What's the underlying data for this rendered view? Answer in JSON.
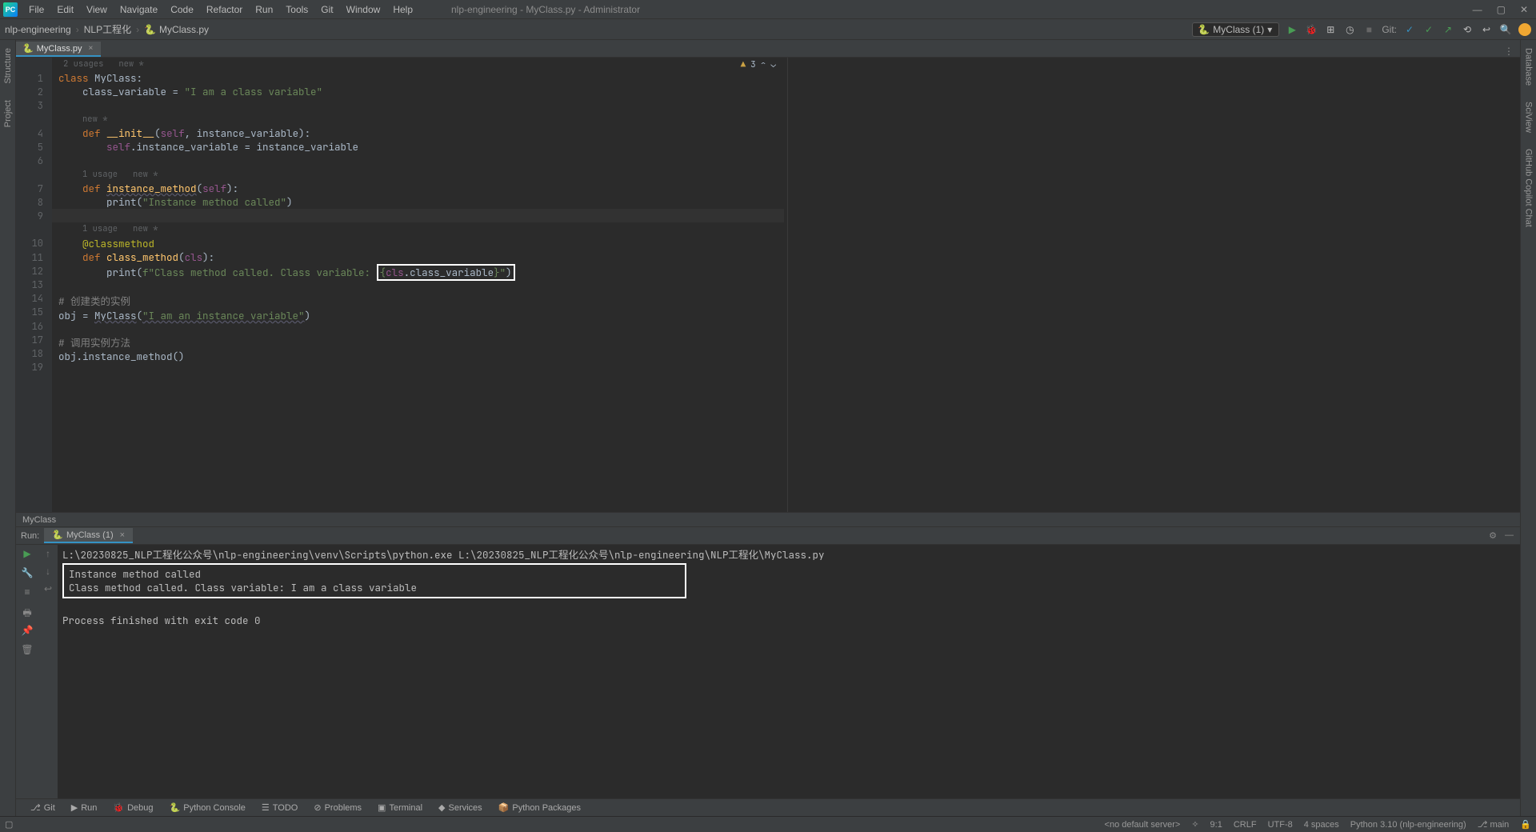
{
  "menu": [
    "File",
    "Edit",
    "View",
    "Navigate",
    "Code",
    "Refactor",
    "Run",
    "Tools",
    "Git",
    "Window",
    "Help"
  ],
  "window_title": "nlp-engineering - MyClass.py - Administrator",
  "breadcrumb": [
    "nlp-engineering",
    "NLP工程化",
    "MyClass.py"
  ],
  "run_config": "MyClass (1)",
  "git_label": "Git:",
  "left_tabs": [
    "Structure",
    "Project"
  ],
  "right_tabs": [
    "Database",
    "SciView",
    "GitHub Copilot Chat"
  ],
  "file_tab": "MyClass.py",
  "inspection": {
    "warnings": "3"
  },
  "code": {
    "hint1_a": "2 usages",
    "hint1_b": "new *",
    "l1_a": "class ",
    "l1_b": "MyClass",
    "l1_c": ":",
    "l2_a": "    class_variable = ",
    "l2_b": "\"I am a class variable\"",
    "hint2_b": "new *",
    "l4_a": "    ",
    "l4_def": "def ",
    "l4_name": "__init__",
    "l4_b": "(",
    "l4_self": "self",
    "l4_c": ", instance_variable):",
    "l5_a": "        ",
    "l5_self": "self",
    "l5_b": ".instance_variable = instance_variable",
    "hint3_a": "1 usage",
    "hint3_b": "new *",
    "l7_a": "    ",
    "l7_def": "def ",
    "l7_name": "instance_method",
    "l7_b": "(",
    "l7_self": "self",
    "l7_c": "):",
    "l8_a": "        ",
    "l8_print": "print",
    "l8_b": "(",
    "l8_str": "\"Instance method called\"",
    "l8_c": ")",
    "hint4_a": "1 usage",
    "hint4_b": "new *",
    "l10": "    @classmethod",
    "l11_a": "    ",
    "l11_def": "def ",
    "l11_name": "class_method",
    "l11_b": "(",
    "l11_cls": "cls",
    "l11_c": "):",
    "l12_a": "        ",
    "l12_print": "print",
    "l12_b": "(",
    "l12_f": "f\"Class method called. Class variable: ",
    "l12_box_open": "{",
    "l12_cls": "cls",
    "l12_dot": ".class_variable",
    "l12_box_close": "}",
    "l12_end": "\")",
    "l14": "# 创建类的实例",
    "l15_a": "obj = ",
    "l15_b": "MyClass",
    "l15_c": "(",
    "l15_d": "\"I am an instance variable\"",
    "l15_e": ")",
    "l17": "# 调用实例方法",
    "l18": "obj.instance_method()"
  },
  "line_numbers": [
    "1",
    "2",
    "3",
    "4",
    "5",
    "6",
    "7",
    "8",
    "9",
    "10",
    "11",
    "12",
    "13",
    "14",
    "15",
    "16",
    "17",
    "18",
    "19"
  ],
  "breadcrumb_bottom": "MyClass",
  "run": {
    "label": "Run:",
    "tab": "MyClass (1)",
    "cmd": "L:\\20230825_NLP工程化公众号\\nlp-engineering\\venv\\Scripts\\python.exe L:\\20230825_NLP工程化公众号\\nlp-engineering\\NLP工程化\\MyClass.py",
    "out1": "Instance method called",
    "out2": "Class method called. Class variable: I am a class variable",
    "exit": "Process finished with exit code 0"
  },
  "bottom_tools": {
    "git": "Git",
    "run": "Run",
    "debug": "Debug",
    "py": "Python Console",
    "todo": "TODO",
    "problems": "Problems",
    "terminal": "Terminal",
    "services": "Services",
    "pkg": "Python Packages"
  },
  "status": {
    "server": "<no default server>",
    "pos": "9:1",
    "eol": "CRLF",
    "enc": "UTF-8",
    "indent": "4 spaces",
    "interp": "Python 3.10 (nlp-engineering)",
    "branch": "main"
  }
}
